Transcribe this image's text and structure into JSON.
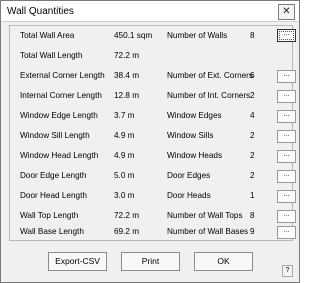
{
  "window": {
    "title": "Wall Quantities",
    "close_glyph": "✕"
  },
  "rows": [
    {
      "label": "Total Wall Area",
      "value": "450.1 sqm",
      "count_label": "Number of Walls",
      "count": "8"
    },
    {
      "label": "Total Wall Length",
      "value": "72.2 m",
      "count_label": "",
      "count": ""
    },
    {
      "label": "External Corner Length",
      "value": "38.4 m",
      "count_label": "Number of Ext. Corners",
      "count": "6"
    },
    {
      "label": "Internal Corner Length",
      "value": "12.8 m",
      "count_label": "Number of Int. Corners",
      "count": "2"
    },
    {
      "label": "Window Edge Length",
      "value": "3.7 m",
      "count_label": "Window Edges",
      "count": "4"
    },
    {
      "label": "Window Sill Length",
      "value": "4.9 m",
      "count_label": "Window Sills",
      "count": "2"
    },
    {
      "label": "Window Head Length",
      "value": "4.9 m",
      "count_label": "Window Heads",
      "count": "2"
    },
    {
      "label": "Door Edge Length",
      "value": "5.0 m",
      "count_label": "Door Edges",
      "count": "2"
    },
    {
      "label": "Door Head Length",
      "value": "3.0 m",
      "count_label": "Door Heads",
      "count": "1"
    },
    {
      "label": "Wall Top Length",
      "value": "72.2 m",
      "count_label": "Number of Wall Tops",
      "count": "8"
    },
    {
      "label": "Wall Base Length",
      "value": "69.2 m",
      "count_label": "Number of Wall Bases",
      "count": "9"
    }
  ],
  "ellipsis_label": "...",
  "buttons": {
    "export": "Export-CSV",
    "print": "Print",
    "ok": "OK",
    "help": "?"
  }
}
